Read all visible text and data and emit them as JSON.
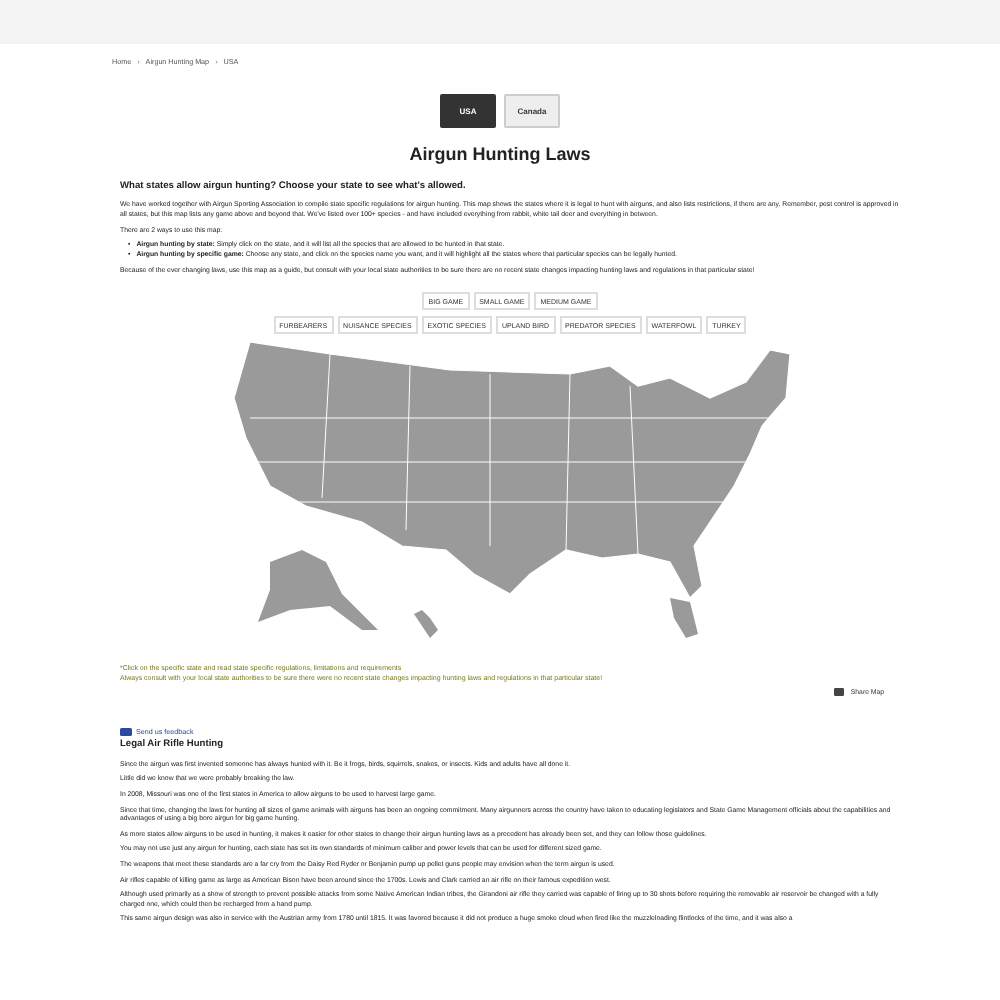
{
  "breadcrumb": [
    {
      "kind": "link",
      "text": "Home"
    },
    {
      "kind": "separator",
      "text": "›"
    },
    {
      "kind": "link",
      "text": "Airgun Hunting Map"
    },
    {
      "kind": "separator",
      "text": "›"
    },
    {
      "kind": "link",
      "text": "USA"
    }
  ],
  "country_tabs": [
    {
      "label": "USA",
      "selected": true
    },
    {
      "label": "Canada",
      "selected": false
    }
  ],
  "title": "Airgun Hunting Laws",
  "intro": {
    "heading": "What states allow airgun hunting? Choose your state to see what's allowed.",
    "paragraph": "We have worked together with Airgun Sporting Association to compile state specific regulations for airgun hunting. This map shows the states where it is legal to hunt with airguns, and also lists restrictions, if there are any. Remember, pest control is approved in all states, but this map lists any game above and beyond that. We've listed over 100+ species - and have included everything from rabbit, white tail deer and everything in between.",
    "ways_label": "There are 2 ways to use this map:",
    "ways": [
      {
        "marker": "•",
        "bold": "Airgun hunting by state:",
        "text": "Simply click on the state, and it will list all the species that are allowed to be hunted in that state."
      },
      {
        "marker": "•",
        "bold": "Airgun hunting by specific game:",
        "text": "Choose any state, and click on the species name you want, and it will highlight all the states where that particular species can be legally hunted."
      }
    ],
    "caution": "Because of the ever changing laws, use this map as a guide, but consult with your local state authorities to be sure there are no recent state changes impacting hunting laws and regulations in that particular state!"
  },
  "filters": [
    [
      "BIG GAME",
      "SMALL GAME",
      "MEDIUM GAME"
    ],
    [
      "FURBEARERS",
      "NUISANCE SPECIES",
      "EXOTIC SPECIES",
      "UPLAND BIRD",
      "PREDATOR SPECIES",
      "WATERFOWL",
      "TURKEY"
    ]
  ],
  "map_notes": [
    "*Click on the specific state and read state specific regulations, limitations and requirements",
    "Always consult with your local state authorities to be sure there were no recent state changes impacting hunting laws and regulations in that particular state!"
  ],
  "share_button": "Share Map",
  "feedback_link": "Send us feedback",
  "article": {
    "heading": "Legal Air Rifle Hunting",
    "paragraphs": [
      "Since the airgun was first invented someone has always hunted with it. Be it frogs, birds, squirrels, snakes, or insects. Kids and adults have all done it.",
      "Little did we know that we were probably breaking the law.",
      "In 2008, Missouri was one of the first states in America to allow airguns to be used to harvest large game.",
      "Since that time, changing the laws for hunting all sizes of game animals with airguns has been an ongoing commitment. Many airgunners across the country have taken to educating legislators and State Game Management officials about the capabilities and advantages of using a big bore airgun for big game hunting.",
      "As more states allow airguns to be used in hunting, it makes it easier for other states to change their airgun hunting laws as a precedent has already been set, and they can follow those guidelines.",
      "You may not use just any airgun for hunting, each state has set its own standards of minimum caliber and power levels that can be used for different sized game.",
      "The weapons that meet these standards are a far cry from the Daisy Red Ryder or Benjamin pump up pellet guns people may envision when the term airgun is used.",
      "Air rifles capable of killing game as large as American Bison have been around since the 1700s. Lewis and Clark carried an air rifle on their famous expedition west.",
      "Although used primarily as a show of strength to prevent possible attacks from some Native American Indian tribes, the Girandoni air rifle they carried was capable of firing up to 30 shots before requiring the removable air reservoir be changed with a fully charged one, which could then be recharged from a hand pump.",
      "This same airgun design was also in service with the Austrian army from 1780 until 1815. It was favored because it did not produce a huge smoke cloud when fired like the muzzleloading flintlocks of the time, and it was also a"
    ]
  }
}
